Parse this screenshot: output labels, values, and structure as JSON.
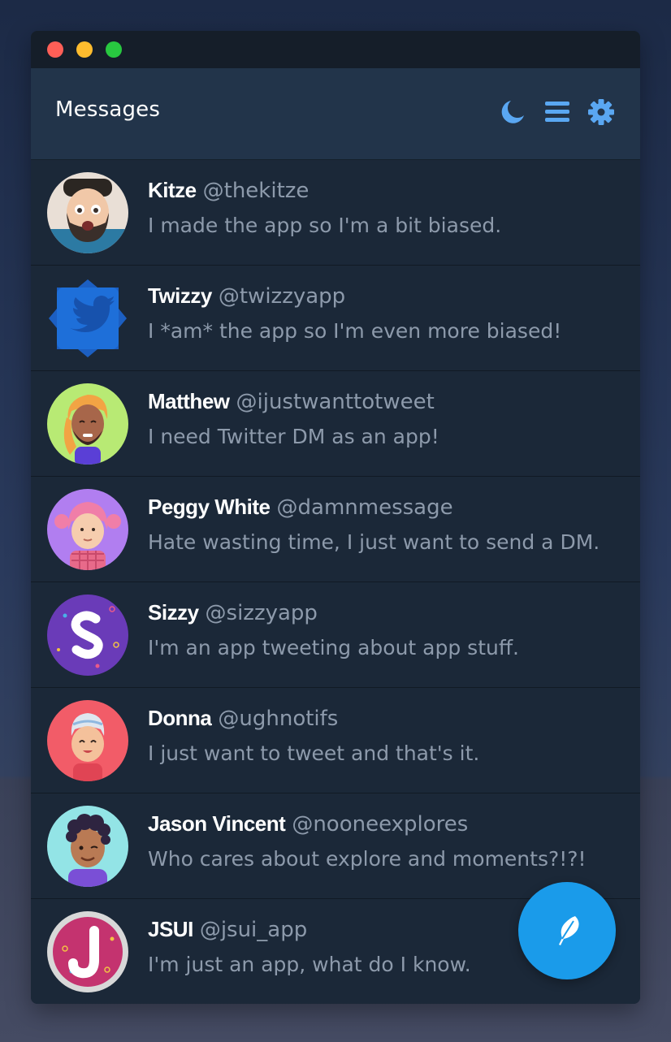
{
  "window": {
    "controls": [
      "close",
      "minimize",
      "maximize"
    ]
  },
  "header": {
    "title": "Messages",
    "icons": [
      "moon-icon",
      "menu-icon",
      "gear-icon"
    ],
    "icon_color": "#5aa7f2"
  },
  "conversations": [
    {
      "name": "Kitze",
      "handle": "@thekitze",
      "message": "I made the app so I'm a bit biased."
    },
    {
      "name": "Twizzy",
      "handle": "@twizzyapp",
      "message": "I *am* the app so I'm even more biased!"
    },
    {
      "name": "Matthew",
      "handle": "@ijustwanttotweet",
      "message": "I need Twitter DM as an app!"
    },
    {
      "name": "Peggy White",
      "handle": "@damnmessage",
      "message": "Hate wasting time, I just want to send a DM."
    },
    {
      "name": "Sizzy",
      "handle": "@sizzyapp",
      "message": "I'm an app tweeting about app stuff."
    },
    {
      "name": "Donna",
      "handle": "@ughnotifs",
      "message": "I just want to tweet and that's it."
    },
    {
      "name": "Jason Vincent",
      "handle": "@nooneexplores",
      "message": "Who cares about explore and moments?!?!"
    },
    {
      "name": "JSUI",
      "handle": "@jsui_app",
      "message": "I'm just an app, what do I know."
    }
  ],
  "compose_button": {
    "icon": "feather-icon",
    "color": "#1a9bea"
  }
}
